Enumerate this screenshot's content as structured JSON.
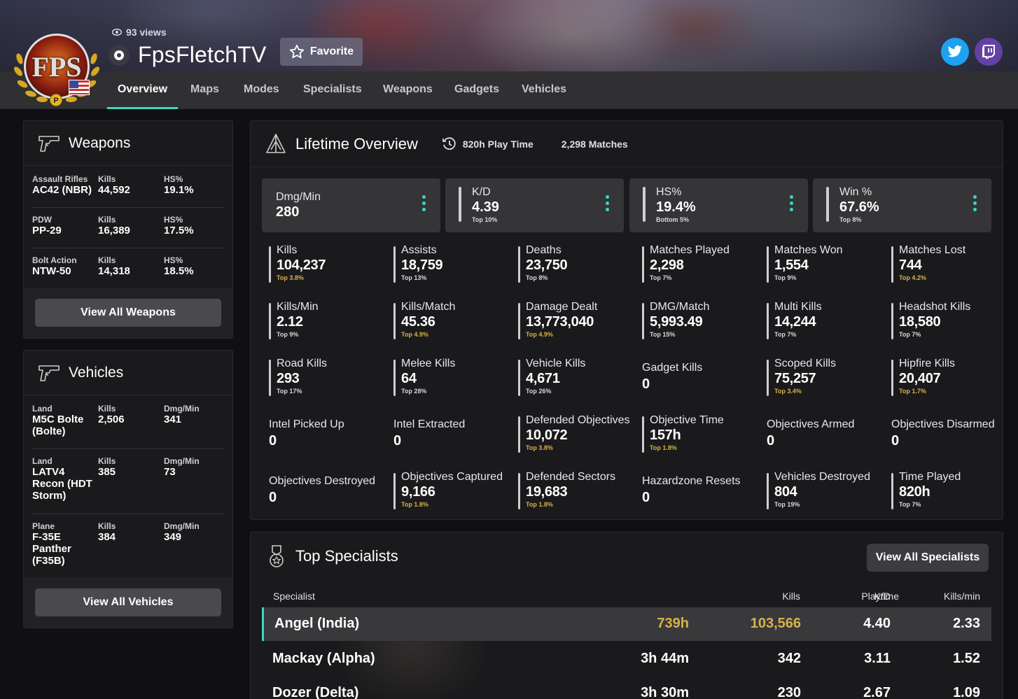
{
  "profile": {
    "views": "93 views",
    "name": "FpsFletchTV",
    "favorite_label": "Favorite",
    "logo_text": "FPS",
    "badge": "P"
  },
  "nav": {
    "tabs": [
      "Overview",
      "Maps",
      "Modes",
      "Specialists",
      "Weapons",
      "Gadgets",
      "Vehicles"
    ],
    "active": "Overview"
  },
  "weapons_card": {
    "title": "Weapons",
    "rows": [
      {
        "category": "Assault Rifles",
        "name": "AC42 (NBR)",
        "kills_label": "Kills",
        "kills": "44,592",
        "hs_label": "HS%",
        "hs": "19.1%"
      },
      {
        "category": "PDW",
        "name": "PP-29",
        "kills_label": "Kills",
        "kills": "16,389",
        "hs_label": "HS%",
        "hs": "17.5%"
      },
      {
        "category": "Bolt Action",
        "name": "NTW-50",
        "kills_label": "Kills",
        "kills": "14,318",
        "hs_label": "HS%",
        "hs": "18.5%"
      }
    ],
    "button": "View All Weapons"
  },
  "vehicles_card": {
    "title": "Vehicles",
    "rows": [
      {
        "category": "Land",
        "name": "M5C Bolte (Bolte)",
        "kills_label": "Kills",
        "kills": "2,506",
        "dmg_label": "Dmg/Min",
        "dmg": "341"
      },
      {
        "category": "Land",
        "name": "LATV4 Recon (HDT Storm)",
        "kills_label": "Kills",
        "kills": "385",
        "dmg_label": "Dmg/Min",
        "dmg": "73"
      },
      {
        "category": "Plane",
        "name": "F-35E Panther (F35B)",
        "kills_label": "Kills",
        "kills": "384",
        "dmg_label": "Dmg/Min",
        "dmg": "349"
      }
    ],
    "button": "View All Vehicles"
  },
  "overview": {
    "title": "Lifetime Overview",
    "playtime": "820h Play Time",
    "matches": "2,298 Matches",
    "big": [
      {
        "label": "Dmg/Min",
        "value": "280",
        "sub": ""
      },
      {
        "label": "K/D",
        "value": "4.39",
        "sub": "Top 10%"
      },
      {
        "label": "HS%",
        "value": "19.4%",
        "sub": "Bottom 5%"
      },
      {
        "label": "Win %",
        "value": "67.6%",
        "sub": "Top 8%"
      }
    ],
    "stats": [
      {
        "label": "Kills",
        "value": "104,237",
        "sub": "Top 3.8%",
        "gold": true
      },
      {
        "label": "Assists",
        "value": "18,759",
        "sub": "Top 13%",
        "gold": false
      },
      {
        "label": "Deaths",
        "value": "23,750",
        "sub": "Top 8%",
        "gold": false
      },
      {
        "label": "Matches Played",
        "value": "2,298",
        "sub": "Top 7%",
        "gold": false
      },
      {
        "label": "Matches Won",
        "value": "1,554",
        "sub": "Top 9%",
        "gold": false
      },
      {
        "label": "Matches Lost",
        "value": "744",
        "sub": "Top 4.2%",
        "gold": true
      },
      {
        "label": "Kills/Min",
        "value": "2.12",
        "sub": "Top 9%",
        "gold": false
      },
      {
        "label": "Kills/Match",
        "value": "45.36",
        "sub": "Top 4.9%",
        "gold": true
      },
      {
        "label": "Damage Dealt",
        "value": "13,773,040",
        "sub": "Top 4.9%",
        "gold": true
      },
      {
        "label": "DMG/Match",
        "value": "5,993.49",
        "sub": "Top 15%",
        "gold": false
      },
      {
        "label": "Multi Kills",
        "value": "14,244",
        "sub": "Top 7%",
        "gold": false
      },
      {
        "label": "Headshot Kills",
        "value": "18,580",
        "sub": "Top 7%",
        "gold": false
      },
      {
        "label": "Road Kills",
        "value": "293",
        "sub": "Top 17%",
        "gold": false
      },
      {
        "label": "Melee Kills",
        "value": "64",
        "sub": "Top 28%",
        "gold": false
      },
      {
        "label": "Vehicle Kills",
        "value": "4,671",
        "sub": "Top 26%",
        "gold": false
      },
      {
        "label": "Gadget Kills",
        "value": "0",
        "sub": "",
        "gold": false
      },
      {
        "label": "Scoped Kills",
        "value": "75,257",
        "sub": "Top 3.4%",
        "gold": true
      },
      {
        "label": "Hipfire Kills",
        "value": "20,407",
        "sub": "Top 1.7%",
        "gold": true
      },
      {
        "label": "Intel Picked Up",
        "value": "0",
        "sub": "",
        "gold": false
      },
      {
        "label": "Intel Extracted",
        "value": "0",
        "sub": "",
        "gold": false
      },
      {
        "label": "Defended Objectives",
        "value": "10,072",
        "sub": "Top 3.8%",
        "gold": true
      },
      {
        "label": "Objective Time",
        "value": "157h",
        "sub": "Top 1.8%",
        "gold": true
      },
      {
        "label": "Objectives Armed",
        "value": "0",
        "sub": "",
        "gold": false
      },
      {
        "label": "Objectives Disarmed",
        "value": "0",
        "sub": "",
        "gold": false
      },
      {
        "label": "Objectives Destroyed",
        "value": "0",
        "sub": "",
        "gold": false
      },
      {
        "label": "Objectives Captured",
        "value": "9,166",
        "sub": "Top 1.8%",
        "gold": true
      },
      {
        "label": "Defended Sectors",
        "value": "19,683",
        "sub": "Top 1.8%",
        "gold": true
      },
      {
        "label": "Hazardzone Resets",
        "value": "0",
        "sub": "",
        "gold": false
      },
      {
        "label": "Vehicles Destroyed",
        "value": "804",
        "sub": "Top 19%",
        "gold": false
      },
      {
        "label": "Time Played",
        "value": "820h",
        "sub": "Top 7%",
        "gold": false
      }
    ]
  },
  "specialists": {
    "title": "Top Specialists",
    "button": "View All Specialists",
    "columns": [
      "Specialist",
      "Playtime",
      "Kills",
      "K/D",
      "Kills/min"
    ],
    "rows": [
      {
        "name": "Angel (India)",
        "playtime": "739h",
        "kills": "103,566",
        "kd": "4.40",
        "kpm": "2.33"
      },
      {
        "name": "Mackay (Alpha)",
        "playtime": "3h 44m",
        "kills": "342",
        "kd": "3.11",
        "kpm": "1.52"
      },
      {
        "name": "Dozer (Delta)",
        "playtime": "3h 30m",
        "kills": "230",
        "kd": "2.67",
        "kpm": "1.09"
      }
    ]
  },
  "colors": {
    "accent": "#3ad7c8",
    "gold": "#d8b14a",
    "twitter": "#1da1f2",
    "twitch": "#6441a5"
  }
}
